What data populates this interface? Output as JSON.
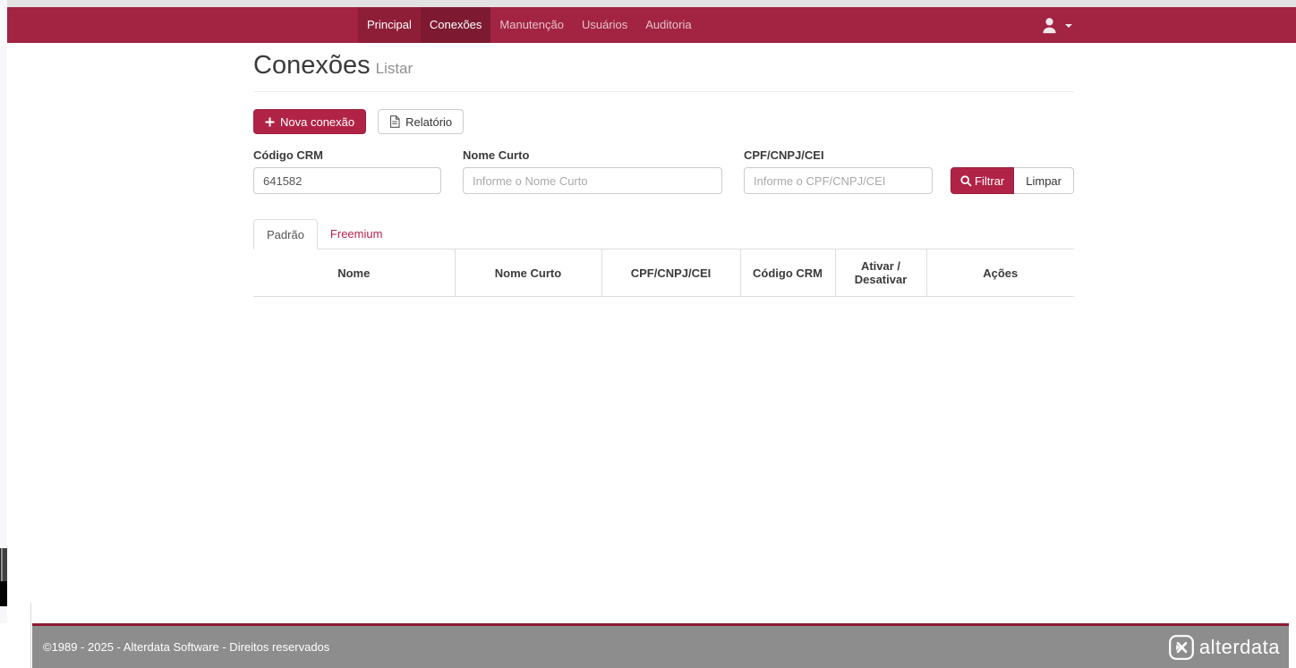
{
  "navbar": {
    "items": [
      {
        "label": "Principal"
      },
      {
        "label": "Conexões"
      },
      {
        "label": "Manutenção"
      },
      {
        "label": "Usuários"
      },
      {
        "label": "Auditoria"
      }
    ],
    "active_item": "Conexões",
    "user_menu_icon": "user-icon"
  },
  "page": {
    "title": "Conexões",
    "subtitle": "Listar"
  },
  "toolbar": {
    "new_connection_label": "Nova conexão",
    "new_connection_icon": "plus-icon",
    "report_label": "Relatório",
    "report_icon": "document-icon"
  },
  "filters": {
    "fields": [
      {
        "label": "Código CRM",
        "value": "641582",
        "placeholder": ""
      },
      {
        "label": "Nome Curto",
        "value": "",
        "placeholder": "Informe o Nome Curto"
      },
      {
        "label": "CPF/CNPJ/CEI",
        "value": "",
        "placeholder": "Informe o CPF/CNPJ/CEI"
      }
    ],
    "filter_label": "Filtrar",
    "filter_icon": "search-icon",
    "clear_label": "Limpar"
  },
  "tabs": [
    {
      "label": "Padrão",
      "active": true
    },
    {
      "label": "Freemium",
      "active": false
    }
  ],
  "table": {
    "headers": [
      "Nome",
      "Nome Curto",
      "CPF/CNPJ/CEI",
      "Código CRM",
      "Ativar / Desativar",
      "Ações"
    ],
    "rows": []
  },
  "footer": {
    "copyright": "©1989 - 2025 - Alterdata Software - Direitos reservados",
    "brand": "alterdata",
    "brand_icon": "alterdata-logo-icon"
  },
  "colors": {
    "accent_red": "#b12346",
    "navbar_bg": "#a22342",
    "navbar_active": "#7d1a32",
    "footer_bg": "#8d8d8d",
    "footer_border": "#8d1b31"
  }
}
